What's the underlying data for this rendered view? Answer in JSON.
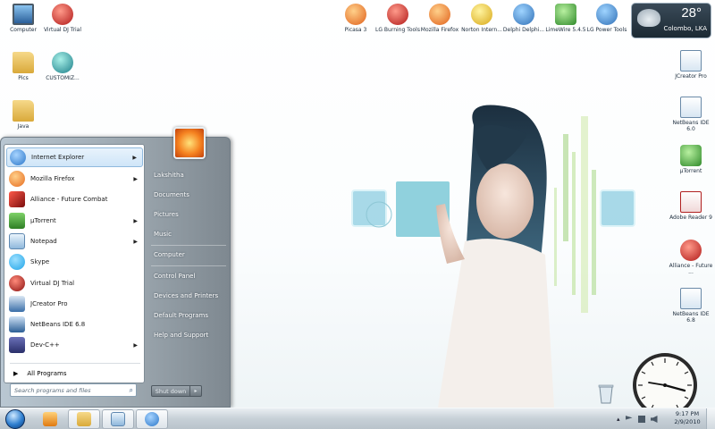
{
  "desktop": {
    "left_icons": [
      {
        "name": "computer",
        "label": "Computer",
        "icon": "monitor-icon"
      },
      {
        "name": "virtual-dj-trial",
        "label": "Virtual DJ Trial",
        "icon": "vinyl-icon"
      },
      {
        "name": "pics",
        "label": "Pics",
        "icon": "folder-icon"
      },
      {
        "name": "customiz",
        "label": "CUSTOMIZ...",
        "icon": "globe-icon"
      },
      {
        "name": "java",
        "label": "Java",
        "icon": "folder-icon"
      }
    ],
    "top_icons": [
      {
        "name": "picasa-3",
        "label": "Picasa 3",
        "icon": "picasa-icon"
      },
      {
        "name": "lg-burning-tools",
        "label": "LG Burning Tools",
        "icon": "disc-icon"
      },
      {
        "name": "mozilla-firefox",
        "label": "Mozilla Firefox",
        "icon": "firefox-icon"
      },
      {
        "name": "norton-internet",
        "label": "Norton Intern...",
        "icon": "norton-icon"
      },
      {
        "name": "delphi-delphi",
        "label": "Delphi Delphi...",
        "icon": "delphi-icon"
      },
      {
        "name": "limewire",
        "label": "LimeWire 5.4.5",
        "icon": "limewire-icon"
      },
      {
        "name": "lg-power-tools",
        "label": "LG Power Tools",
        "icon": "power-tools-icon"
      }
    ],
    "right_icons": [
      {
        "name": "jcreator-pro",
        "label": "JCreator Pro",
        "icon": "jcreator-icon"
      },
      {
        "name": "netbeans-ide-6-0",
        "label": "NetBeans IDE 6.0",
        "icon": "netbeans-icon"
      },
      {
        "name": "utorrent",
        "label": "µTorrent",
        "icon": "utorrent-icon"
      },
      {
        "name": "adobe-reader-9",
        "label": "Adobe Reader 9",
        "icon": "pdf-icon"
      },
      {
        "name": "alliance-future",
        "label": "Alliance - Future ...",
        "icon": "alliance-icon"
      },
      {
        "name": "netbeans-ide-6-8",
        "label": "NetBeans IDE 6.8",
        "icon": "netbeans-icon"
      }
    ]
  },
  "weather": {
    "temp": "28°",
    "city": "Colombo, LKA"
  },
  "start_menu": {
    "pinned": [
      {
        "label": "Internet Explorer",
        "submenu": true,
        "icon": "ie-icon",
        "color": "#2a76c9",
        "highlight": true
      },
      {
        "label": "Mozilla Firefox",
        "submenu": true,
        "icon": "firefox-icon",
        "color": "#e66b1f"
      },
      {
        "label": "Alliance - Future Combat",
        "submenu": false,
        "icon": "alliance-icon",
        "color": "#c01a1a"
      },
      {
        "label": "µTorrent",
        "submenu": true,
        "icon": "utorrent-icon",
        "color": "#3f9c2f"
      },
      {
        "label": "Notepad",
        "submenu": true,
        "icon": "notepad-icon",
        "color": "#6fa5d6"
      },
      {
        "label": "Skype",
        "submenu": false,
        "icon": "skype-icon",
        "color": "#1ea4e8"
      },
      {
        "label": "Virtual DJ Trial",
        "submenu": false,
        "icon": "vinyl-icon",
        "color": "#b81e1e"
      },
      {
        "label": "JCreator Pro",
        "submenu": false,
        "icon": "jcreator-icon",
        "color": "#3a6ea8"
      },
      {
        "label": "NetBeans IDE 6.8",
        "submenu": false,
        "icon": "netbeans-icon",
        "color": "#2b5e95"
      },
      {
        "label": "Dev-C++",
        "submenu": true,
        "icon": "devcpp-icon",
        "color": "#3a3f7a"
      }
    ],
    "all_programs": "All Programs",
    "search_placeholder": "Search programs and files",
    "right_items": [
      "Lakshitha",
      "Documents",
      "Pictures",
      "Music",
      "Computer",
      "Control Panel",
      "Devices and Printers",
      "Default Programs",
      "Help and Support"
    ],
    "shutdown": "Shut down"
  },
  "taskbar": {
    "clock_time": "9:17 PM",
    "clock_date": "2/9/2010"
  }
}
